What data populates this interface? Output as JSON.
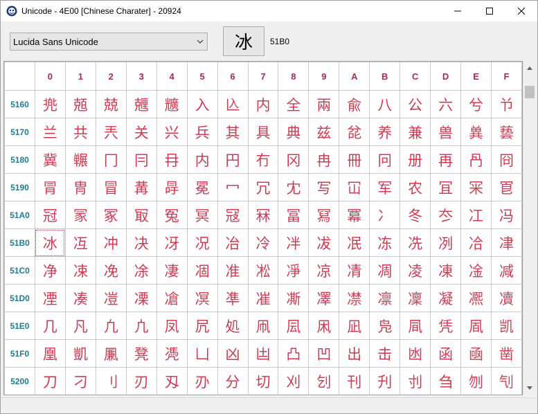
{
  "window": {
    "title": "Unicode - 4E00 [Chinese Charater] - 20924",
    "minimize_icon": "minimize-icon",
    "maximize_icon": "maximize-icon",
    "close_icon": "close-icon"
  },
  "toolbar": {
    "font_value": "Lucida Sans Unicode",
    "preview_char": "冰",
    "selected_code": "51B0"
  },
  "grid": {
    "columns": [
      "0",
      "1",
      "2",
      "3",
      "4",
      "5",
      "6",
      "7",
      "8",
      "9",
      "A",
      "B",
      "C",
      "D",
      "E",
      "F"
    ],
    "rows": [
      {
        "code": "5160",
        "chars": [
          "兠",
          "兡",
          "兢",
          "兣",
          "兤",
          "入",
          "兦",
          "内",
          "全",
          "兩",
          "兪",
          "八",
          "公",
          "六",
          "兮",
          "兯"
        ]
      },
      {
        "code": "5170",
        "chars": [
          "兰",
          "共",
          "兲",
          "关",
          "兴",
          "兵",
          "其",
          "具",
          "典",
          "兹",
          "兺",
          "养",
          "兼",
          "兽",
          "兾",
          "兿"
        ]
      },
      {
        "code": "5180",
        "chars": [
          "冀",
          "冁",
          "冂",
          "冃",
          "冄",
          "内",
          "円",
          "冇",
          "冈",
          "冉",
          "冊",
          "冋",
          "册",
          "再",
          "冎",
          "冏"
        ]
      },
      {
        "code": "5190",
        "chars": [
          "冐",
          "冑",
          "冒",
          "冓",
          "冔",
          "冕",
          "冖",
          "冗",
          "冘",
          "写",
          "冚",
          "军",
          "农",
          "冝",
          "冞",
          "冟"
        ]
      },
      {
        "code": "51A0",
        "chars": [
          "冠",
          "冡",
          "冢",
          "冣",
          "冤",
          "冥",
          "冦",
          "冧",
          "冨",
          "冩",
          "冪",
          "冫",
          "冬",
          "冭",
          "冮",
          "冯"
        ]
      },
      {
        "code": "51B0",
        "chars": [
          "冰",
          "冱",
          "冲",
          "决",
          "冴",
          "况",
          "冶",
          "冷",
          "冸",
          "冹",
          "冺",
          "冻",
          "冼",
          "冽",
          "冾",
          "冿"
        ]
      },
      {
        "code": "51C0",
        "chars": [
          "净",
          "凁",
          "凂",
          "凃",
          "凄",
          "凅",
          "准",
          "凇",
          "凈",
          "凉",
          "凊",
          "凋",
          "凌",
          "凍",
          "凎",
          "减"
        ]
      },
      {
        "code": "51D0",
        "chars": [
          "凐",
          "凑",
          "凒",
          "凓",
          "凔",
          "凕",
          "凖",
          "凗",
          "凘",
          "凙",
          "凚",
          "凛",
          "凜",
          "凝",
          "凞",
          "凟"
        ]
      },
      {
        "code": "51E0",
        "chars": [
          "几",
          "凡",
          "凢",
          "凣",
          "凤",
          "凥",
          "処",
          "凧",
          "凨",
          "凩",
          "凪",
          "凫",
          "凬",
          "凭",
          "凮",
          "凯"
        ]
      },
      {
        "code": "51F0",
        "chars": [
          "凰",
          "凱",
          "凲",
          "凳",
          "凴",
          "凵",
          "凶",
          "凷",
          "凸",
          "凹",
          "出",
          "击",
          "凼",
          "函",
          "凾",
          "凿"
        ]
      },
      {
        "code": "5200",
        "chars": [
          "刀",
          "刁",
          "刂",
          "刃",
          "刄",
          "刅",
          "分",
          "切",
          "刈",
          "刉",
          "刊",
          "刋",
          "刌",
          "刍",
          "刎",
          "刏"
        ]
      }
    ]
  },
  "selected_row": 5,
  "selected_col": 0,
  "colors": {
    "header_col": "#a0304a",
    "header_row": "#1d7d8c",
    "cell_text": "#d23a52"
  }
}
